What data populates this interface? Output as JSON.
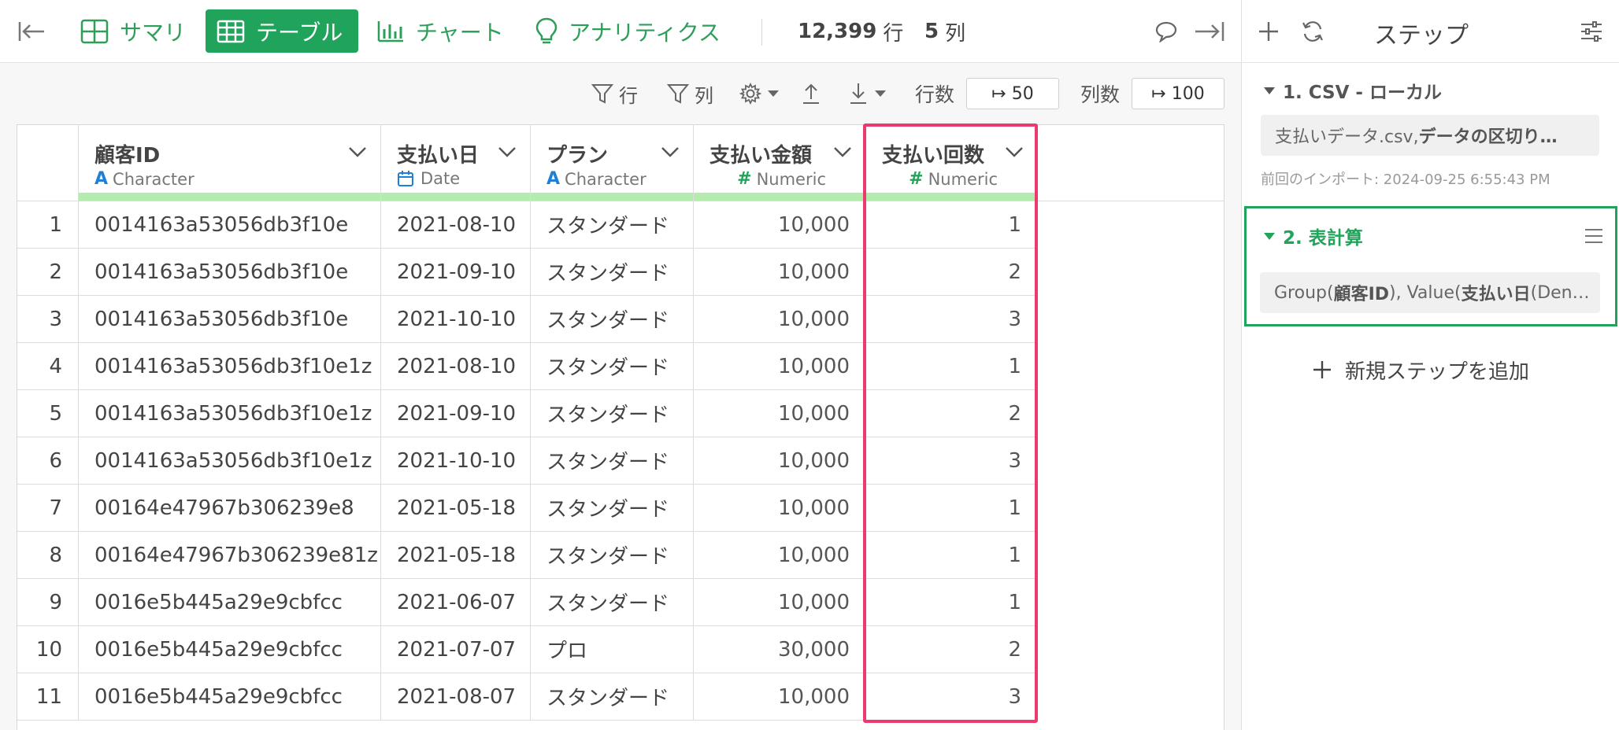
{
  "toolbar": {
    "tabs": [
      {
        "label": "サマリ",
        "icon": "summary-grid-icon"
      },
      {
        "label": "テーブル",
        "icon": "table-icon",
        "active": true
      },
      {
        "label": "チャート",
        "icon": "bar-chart-icon"
      },
      {
        "label": "アナリティクス",
        "icon": "lightbulb-icon"
      }
    ],
    "row_count": "12,399",
    "row_unit": "行",
    "col_count": "5",
    "col_unit": "列"
  },
  "table_toolbar": {
    "filter_row_label": "行",
    "filter_col_label": "列",
    "rows_label": "行数",
    "rows_value": "↦ 50",
    "cols_label": "列数",
    "cols_value": "↦ 100"
  },
  "columns": [
    {
      "name": "顧客ID",
      "type": "Character",
      "type_icon": "A"
    },
    {
      "name": "支払い日",
      "type": "Date",
      "type_icon": "calendar"
    },
    {
      "name": "プラン",
      "type": "Character",
      "type_icon": "A"
    },
    {
      "name": "支払い金額",
      "type": "Numeric",
      "type_icon": "#"
    },
    {
      "name": "支払い回数",
      "type": "Numeric",
      "type_icon": "#"
    }
  ],
  "rows": [
    [
      "1",
      "0014163a53056db3f10e",
      "2021-08-10",
      "スタンダード",
      "10,000",
      "1"
    ],
    [
      "2",
      "0014163a53056db3f10e",
      "2021-09-10",
      "スタンダード",
      "10,000",
      "2"
    ],
    [
      "3",
      "0014163a53056db3f10e",
      "2021-10-10",
      "スタンダード",
      "10,000",
      "3"
    ],
    [
      "4",
      "0014163a53056db3f10e1z",
      "2021-08-10",
      "スタンダード",
      "10,000",
      "1"
    ],
    [
      "5",
      "0014163a53056db3f10e1z",
      "2021-09-10",
      "スタンダード",
      "10,000",
      "2"
    ],
    [
      "6",
      "0014163a53056db3f10e1z",
      "2021-10-10",
      "スタンダード",
      "10,000",
      "3"
    ],
    [
      "7",
      "00164e47967b306239e8",
      "2021-05-18",
      "スタンダード",
      "10,000",
      "1"
    ],
    [
      "8",
      "00164e47967b306239e81z",
      "2021-05-18",
      "スタンダード",
      "10,000",
      "1"
    ],
    [
      "9",
      "0016e5b445a29e9cbfcc",
      "2021-06-07",
      "スタンダード",
      "10,000",
      "1"
    ],
    [
      "10",
      "0016e5b445a29e9cbfcc",
      "2021-07-07",
      "プロ",
      "30,000",
      "2"
    ],
    [
      "11",
      "0016e5b445a29e9cbfcc",
      "2021-08-07",
      "スタンダード",
      "10,000",
      "3"
    ]
  ],
  "panel": {
    "title": "ステップ",
    "step1": {
      "title": "1. CSV - ローカル",
      "body_plain": "支払いデータ.csv, ",
      "body_bold": "データの区切り…",
      "meta": "前回のインポート: 2024-09-25 6:55:43 PM"
    },
    "step2": {
      "title": "2. 表計算",
      "body_1": "Group(",
      "body_2": "顧客ID",
      "body_3": "), Value(",
      "body_4": "支払い日",
      "body_5": " (Den…"
    },
    "add_step": "新規ステップを追加"
  },
  "colors": {
    "accent": "#20a35a",
    "highlight": "#ec3a6e",
    "header_bar": "#b4ecad"
  }
}
